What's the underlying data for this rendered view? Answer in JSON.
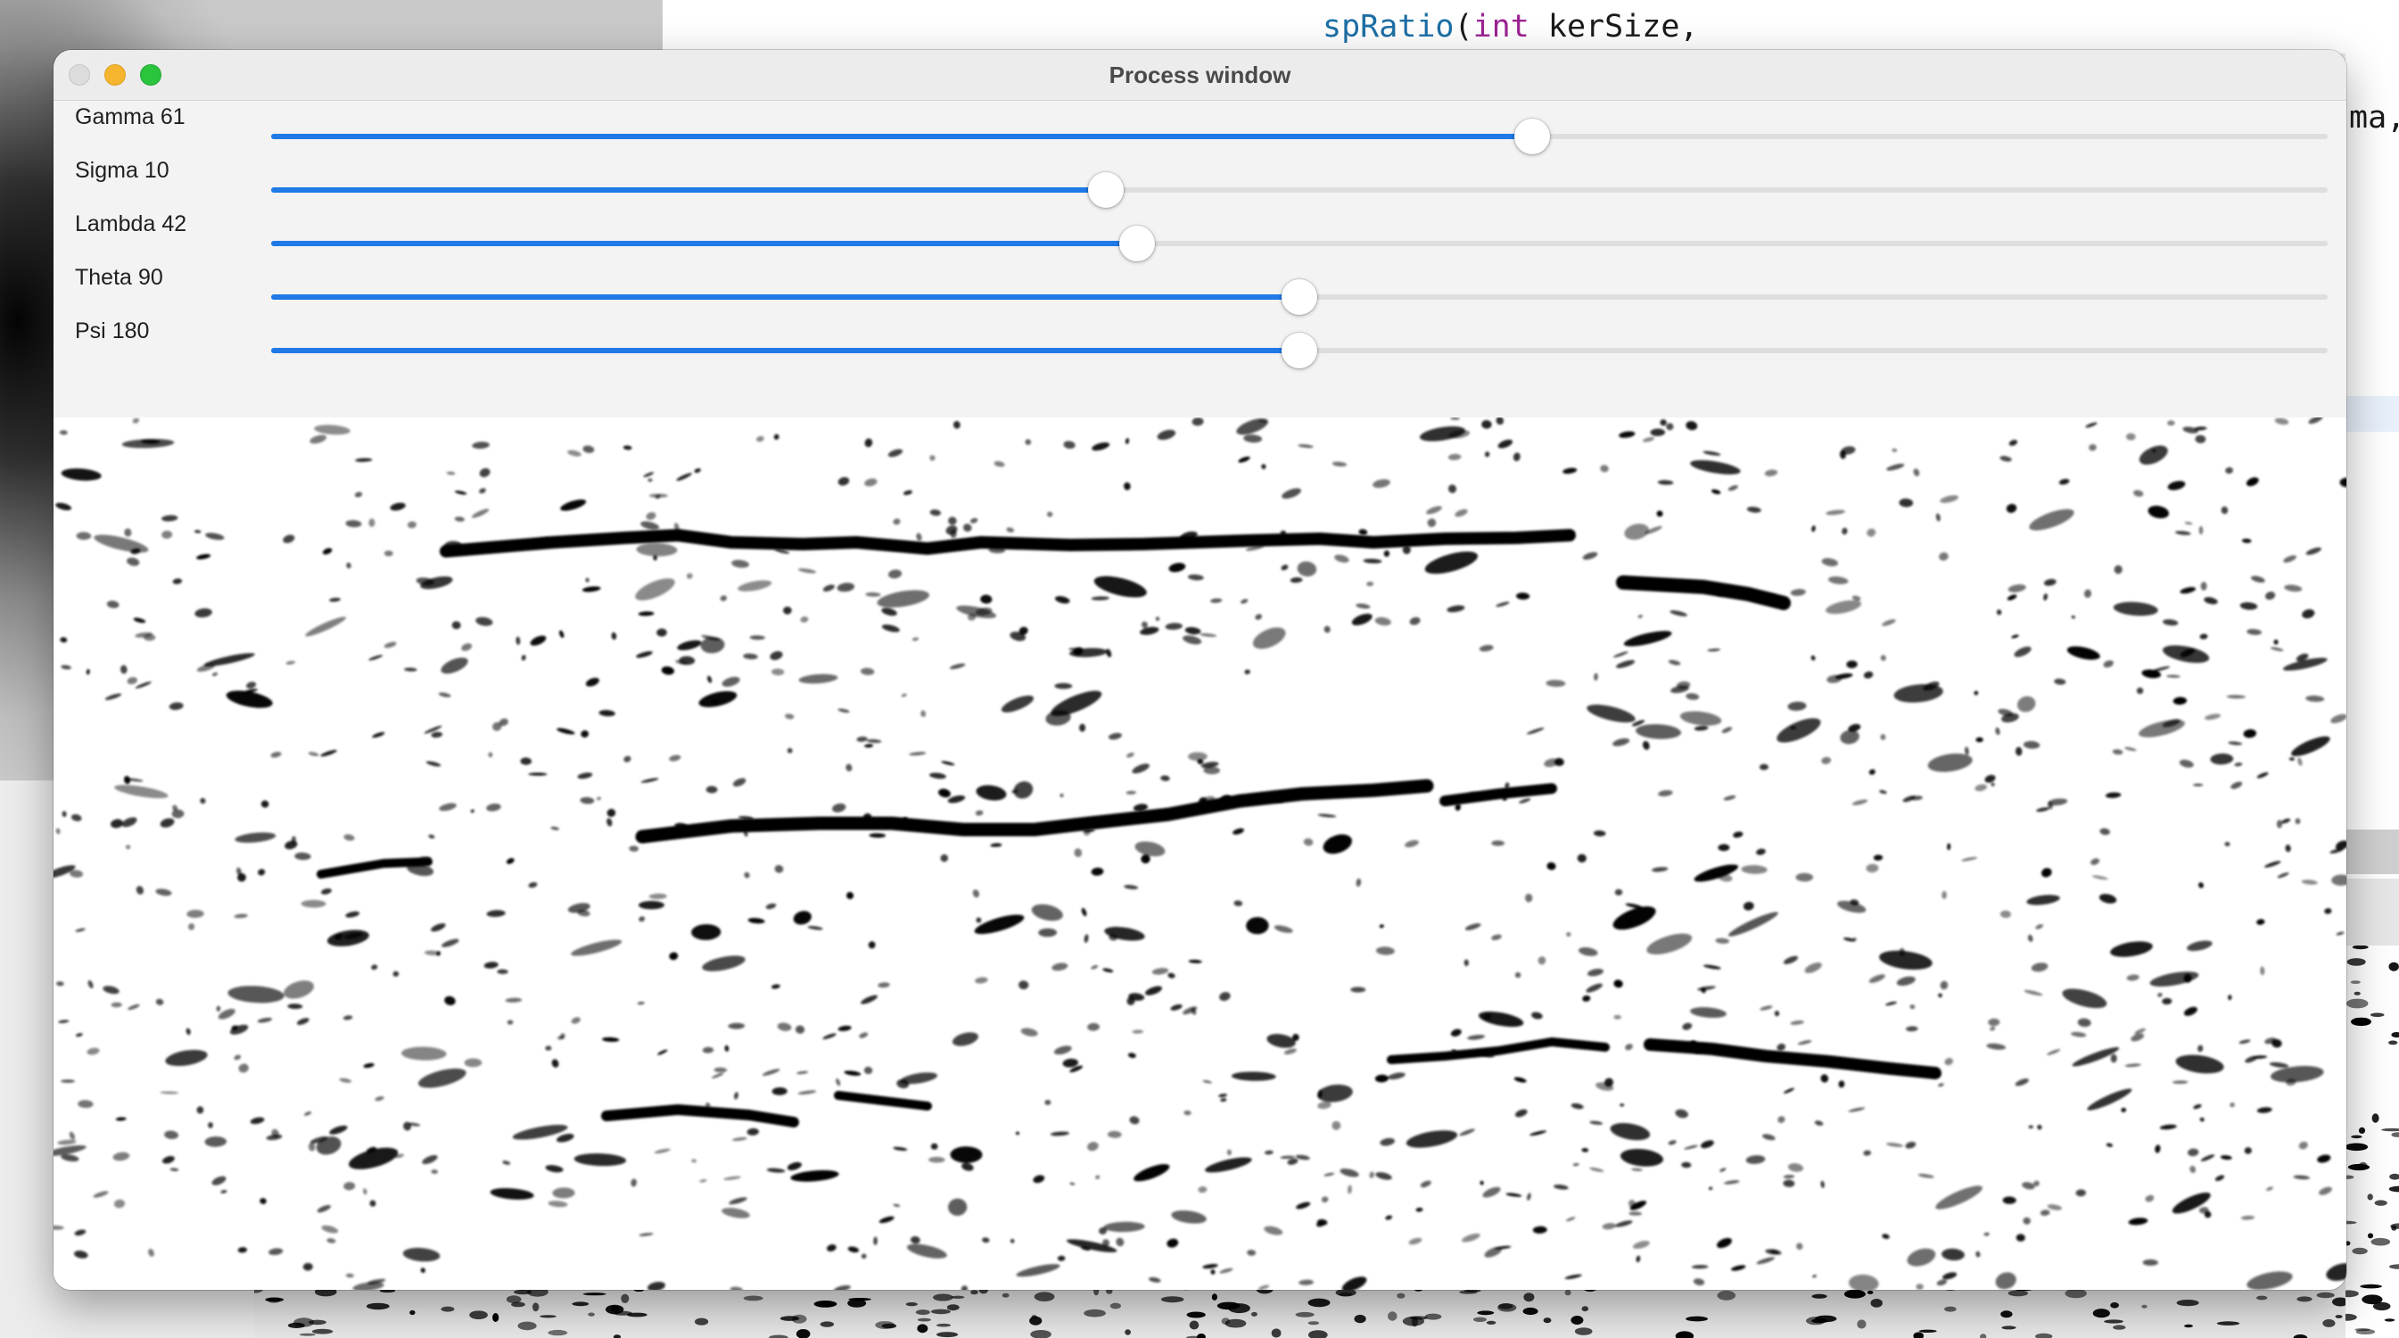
{
  "background": {
    "code_segments": [
      {
        "text": "spRatio",
        "kind": "fn"
      },
      {
        "text": "(",
        "kind": "plain"
      },
      {
        "text": "int",
        "kind": "kw"
      },
      {
        "text": " kerSize,",
        "kind": "plain"
      }
    ],
    "right_code_text": "ma,"
  },
  "window": {
    "title": "Process window"
  },
  "trackbars": [
    {
      "label": "Gamma",
      "value": "61",
      "fraction": 0.613
    },
    {
      "label": "Sigma",
      "value": "10",
      "fraction": 0.406
    },
    {
      "label": "Lambda",
      "value": "42",
      "fraction": 0.421
    },
    {
      "label": "Theta",
      "value": "90",
      "fraction": 0.5
    },
    {
      "label": "Psi",
      "value": "180",
      "fraction": 0.5
    }
  ],
  "image": {
    "description_name": "gabor-filter-output",
    "ink_color": "#000000",
    "paper_color": "#ffffff"
  },
  "colors": {
    "accent": "#1f7ae6",
    "close_button": "#dcdcdc",
    "minimize_button": "#f5b52e",
    "zoom_button": "#2ac43d"
  }
}
